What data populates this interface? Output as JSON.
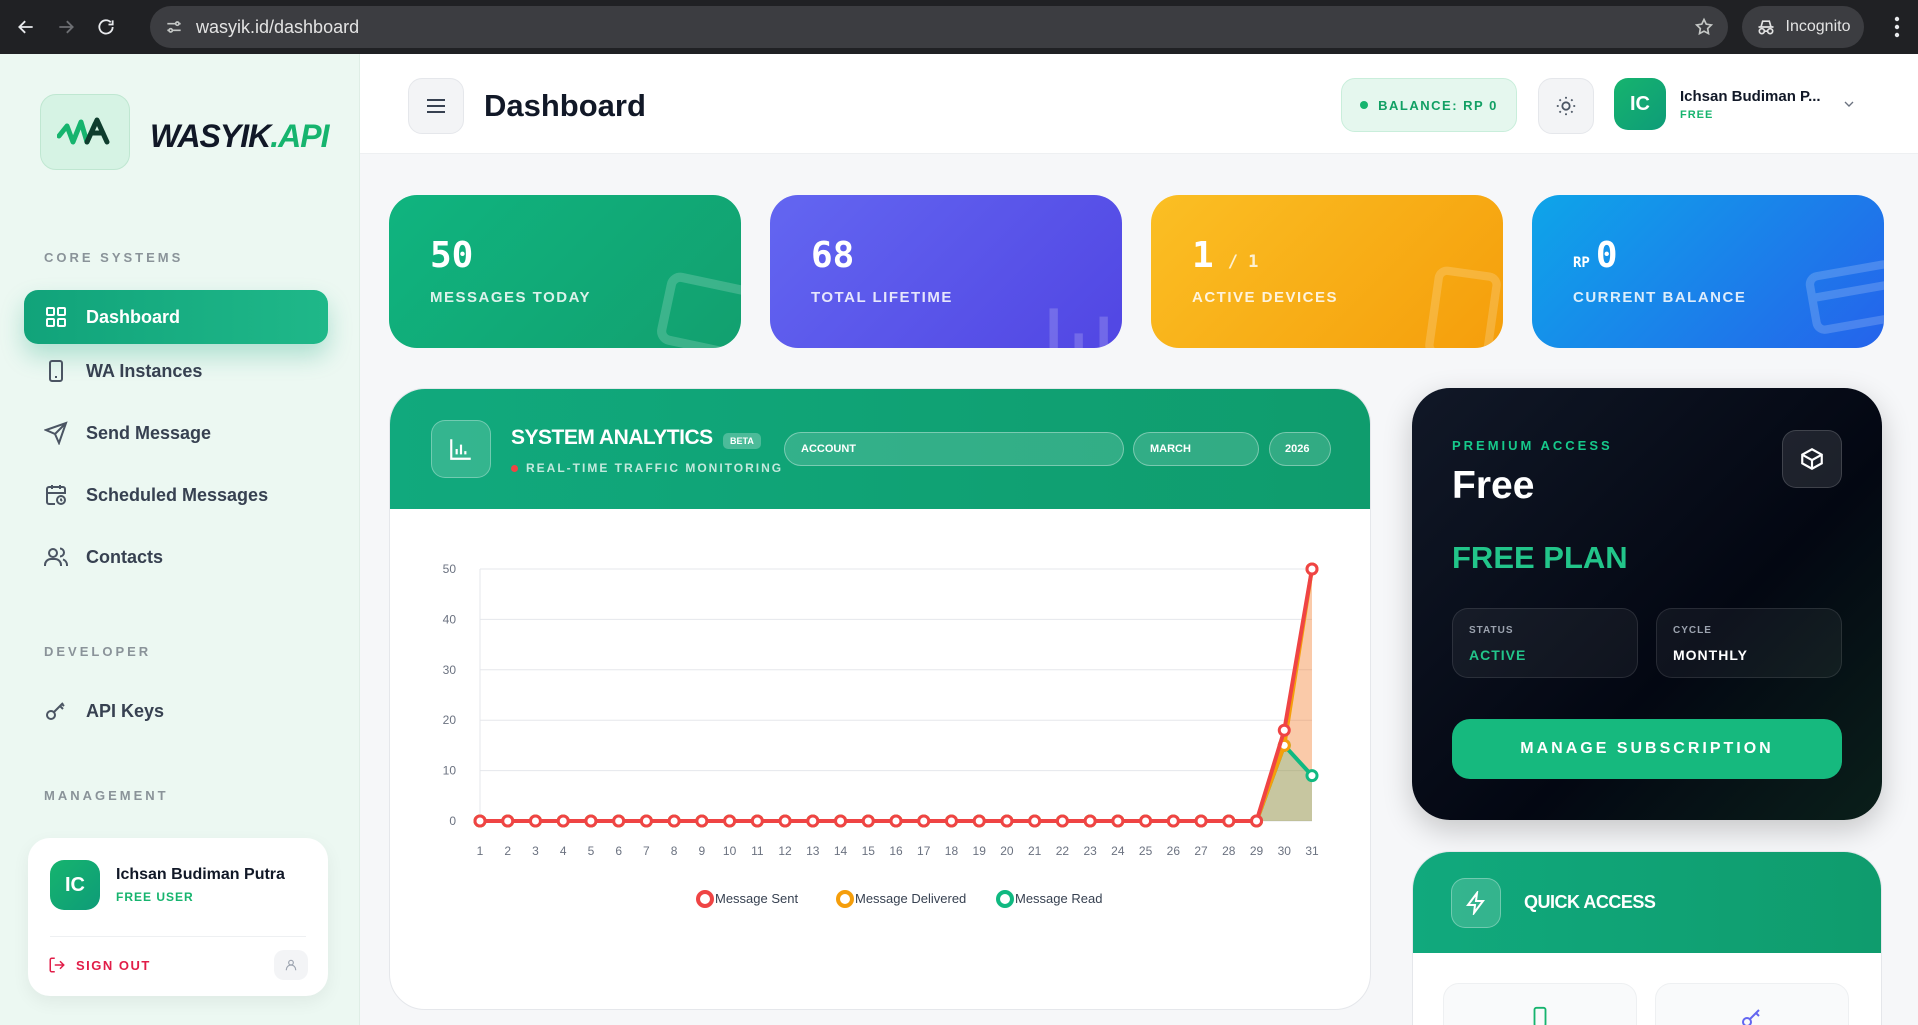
{
  "browser": {
    "url": "wasyik.id/dashboard",
    "mode_label": "Incognito"
  },
  "brand": {
    "name_main": "WASYIK",
    "name_api": ".API",
    "accent_color": "#16b46e"
  },
  "sidebar": {
    "sections": {
      "core": "CORE SYSTEMS",
      "developer": "DEVELOPER",
      "management": "MANAGEMENT"
    },
    "items": [
      {
        "label": "Dashboard",
        "icon": "grid-icon",
        "active": true
      },
      {
        "label": "WA Instances",
        "icon": "phone-icon"
      },
      {
        "label": "Send Message",
        "icon": "send-icon"
      },
      {
        "label": "Scheduled Messages",
        "icon": "calendar-clock-icon"
      },
      {
        "label": "Contacts",
        "icon": "users-icon"
      },
      {
        "label": "API Keys",
        "icon": "key-icon"
      }
    ],
    "user": {
      "initials": "IC",
      "name": "Ichsan Budiman Putra",
      "role": "FREE USER",
      "signout": "SIGN OUT"
    }
  },
  "header": {
    "title": "Dashboard",
    "balance": "BALANCE: RP 0",
    "user": {
      "initials": "IC",
      "name": "Ichsan Budiman P...",
      "plan": "FREE"
    }
  },
  "stats": [
    {
      "value": "50",
      "label": "MESSAGES TODAY",
      "color": "#10b47f"
    },
    {
      "value": "68",
      "label": "TOTAL LIFETIME",
      "color": "#6366f1"
    },
    {
      "value": "1",
      "sub": "/ 1",
      "label": "ACTIVE DEVICES",
      "color": "#f59e0b"
    },
    {
      "currency": "RP",
      "value": "0",
      "label": "CURRENT BALANCE",
      "color": "#0ea5e9"
    }
  ],
  "analytics": {
    "title": "SYSTEM ANALYTICS",
    "badge": "BETA",
    "subtitle": "REAL-TIME TRAFFIC MONITORING",
    "filters": {
      "account": "ACCOUNT",
      "month": "MARCH",
      "year": "2026"
    }
  },
  "chart_data": {
    "type": "line",
    "x": [
      1,
      2,
      3,
      4,
      5,
      6,
      7,
      8,
      9,
      10,
      11,
      12,
      13,
      14,
      15,
      16,
      17,
      18,
      19,
      20,
      21,
      22,
      23,
      24,
      25,
      26,
      27,
      28,
      29,
      30,
      31
    ],
    "series": [
      {
        "name": "Message Sent",
        "color": "#ef4444",
        "values": [
          0,
          0,
          0,
          0,
          0,
          0,
          0,
          0,
          0,
          0,
          0,
          0,
          0,
          0,
          0,
          0,
          0,
          0,
          0,
          0,
          0,
          0,
          0,
          0,
          0,
          0,
          0,
          0,
          0,
          18,
          50
        ]
      },
      {
        "name": "Message Delivered",
        "color": "#f59e0b",
        "values": [
          0,
          0,
          0,
          0,
          0,
          0,
          0,
          0,
          0,
          0,
          0,
          0,
          0,
          0,
          0,
          0,
          0,
          0,
          0,
          0,
          0,
          0,
          0,
          0,
          0,
          0,
          0,
          0,
          0,
          15,
          50
        ]
      },
      {
        "name": "Message Read",
        "color": "#10b981",
        "values": [
          0,
          0,
          0,
          0,
          0,
          0,
          0,
          0,
          0,
          0,
          0,
          0,
          0,
          0,
          0,
          0,
          0,
          0,
          0,
          0,
          0,
          0,
          0,
          0,
          0,
          0,
          0,
          0,
          0,
          15,
          9
        ]
      }
    ],
    "ylim": [
      0,
      50
    ],
    "yticks": [
      0,
      10,
      20,
      30,
      40,
      50
    ],
    "grid": true,
    "legend": "bottom"
  },
  "premium": {
    "label": "PREMIUM ACCESS",
    "name": "Free",
    "plan": "FREE PLAN",
    "status_key": "STATUS",
    "status_value": "ACTIVE",
    "cycle_key": "CYCLE",
    "cycle_value": "MONTHLY",
    "button": "MANAGE SUBSCRIPTION"
  },
  "quick_access": {
    "title": "QUICK ACCESS"
  }
}
